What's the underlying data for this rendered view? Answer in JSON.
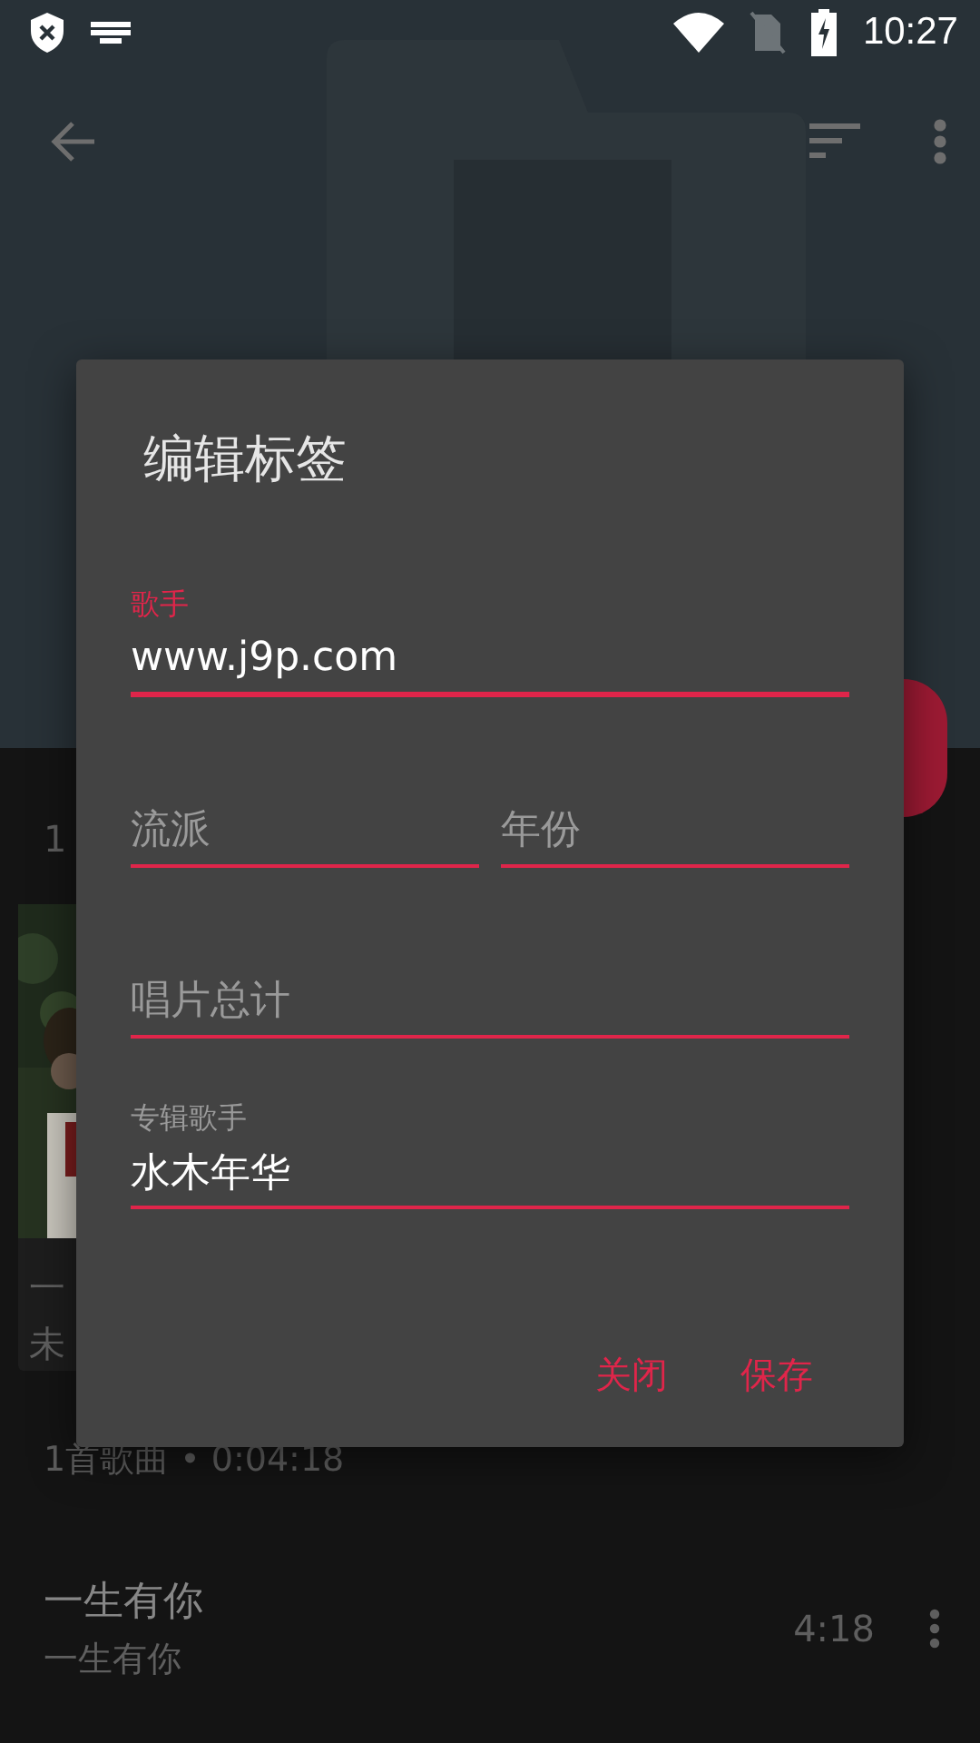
{
  "status_bar": {
    "time": "10:27"
  },
  "library": {
    "count_partial": "1",
    "album_card": {
      "title_partial": "一",
      "subtitle_partial": "未"
    },
    "summary": "1首歌曲 • 0:04:18",
    "songs": [
      {
        "title": "一生有你",
        "artist": "一生有你",
        "duration": "4:18"
      }
    ]
  },
  "dialog": {
    "title": "编辑标签",
    "rows": [
      [
        {
          "label": "歌手",
          "value": "www.j9p.com",
          "focused": true
        }
      ],
      [
        {
          "placeholder": "流派",
          "focused": false
        },
        {
          "placeholder": "年份",
          "focused": false
        }
      ],
      [
        {
          "placeholder": "唱片总计",
          "focused": false
        }
      ],
      [
        {
          "label": "专辑歌手",
          "value": "水木年华",
          "focused": false
        }
      ]
    ],
    "buttons": [
      "关闭",
      "保存"
    ]
  }
}
